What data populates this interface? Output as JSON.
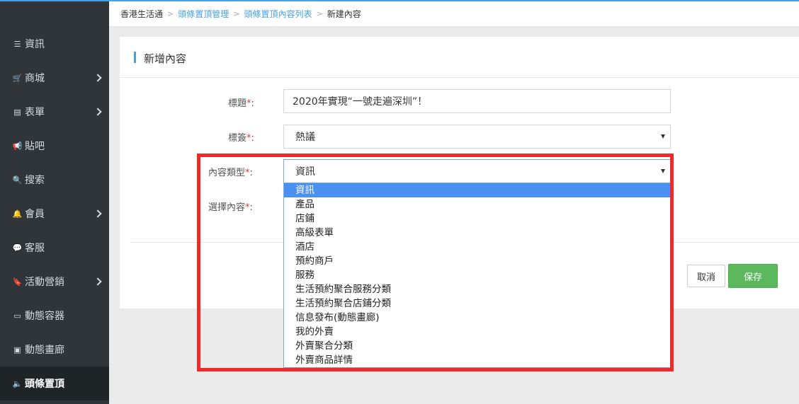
{
  "sidebar": {
    "items": [
      {
        "label": "資訊",
        "icon": "list-icon",
        "glyph": "☰",
        "has_arrow": false,
        "active": false
      },
      {
        "label": "商城",
        "icon": "cart-icon",
        "glyph": "🛒",
        "has_arrow": true,
        "active": false
      },
      {
        "label": "表單",
        "icon": "form-icon",
        "glyph": "▤",
        "has_arrow": true,
        "active": false
      },
      {
        "label": "貼吧",
        "icon": "megaphone-icon",
        "glyph": "📢",
        "has_arrow": false,
        "active": false
      },
      {
        "label": "搜索",
        "icon": "search-icon",
        "glyph": "🔍",
        "has_arrow": false,
        "active": false
      },
      {
        "label": "會員",
        "icon": "bell-icon",
        "glyph": "🔔",
        "has_arrow": true,
        "active": false
      },
      {
        "label": "客服",
        "icon": "comment-icon",
        "glyph": "💬",
        "has_arrow": false,
        "active": false
      },
      {
        "label": "活動營銷",
        "icon": "bookmark-icon",
        "glyph": "🔖",
        "has_arrow": true,
        "active": false
      },
      {
        "label": "動態容器",
        "icon": "inbox-icon",
        "glyph": "▭",
        "has_arrow": false,
        "active": false
      },
      {
        "label": "動態畫廊",
        "icon": "image-icon",
        "glyph": "▣",
        "has_arrow": false,
        "active": false
      },
      {
        "label": "頭條置頂",
        "icon": "volume-icon",
        "glyph": "🔈",
        "has_arrow": false,
        "active": true
      }
    ]
  },
  "breadcrumb": {
    "items": [
      "香港生活通",
      "頭條置頂管理",
      "頭條置頂內容列表"
    ],
    "current": "新建內容"
  },
  "panel": {
    "title": "新增內容"
  },
  "form": {
    "title_label": "標題",
    "title_value": "2020年實現“一號走遍深圳”！",
    "tag_label": "標簽",
    "tag_value": "熱議",
    "type_label": "內容類型",
    "type_value": "資訊",
    "content_label": "選擇內容",
    "required_mark": "*",
    "colon": ":"
  },
  "dropdown": {
    "options": [
      "資訊",
      "產品",
      "店鋪",
      "高級表單",
      "酒店",
      "預約商戶",
      "服務",
      "生活預約聚合服務分類",
      "生活預約聚合店鋪分類",
      "信息發布(動態畫廊)",
      "我的外賣",
      "外賣聚合分類",
      "外賣商品詳情"
    ],
    "selected_index": 0
  },
  "buttons": {
    "cancel": "取消",
    "save": "保存"
  },
  "colors": {
    "accent": "#47a1e0",
    "highlight": "#ee2a2a",
    "save_green": "#5cb85c",
    "sidebar_bg": "#2f3539",
    "selected_option": "#4a90f0"
  }
}
